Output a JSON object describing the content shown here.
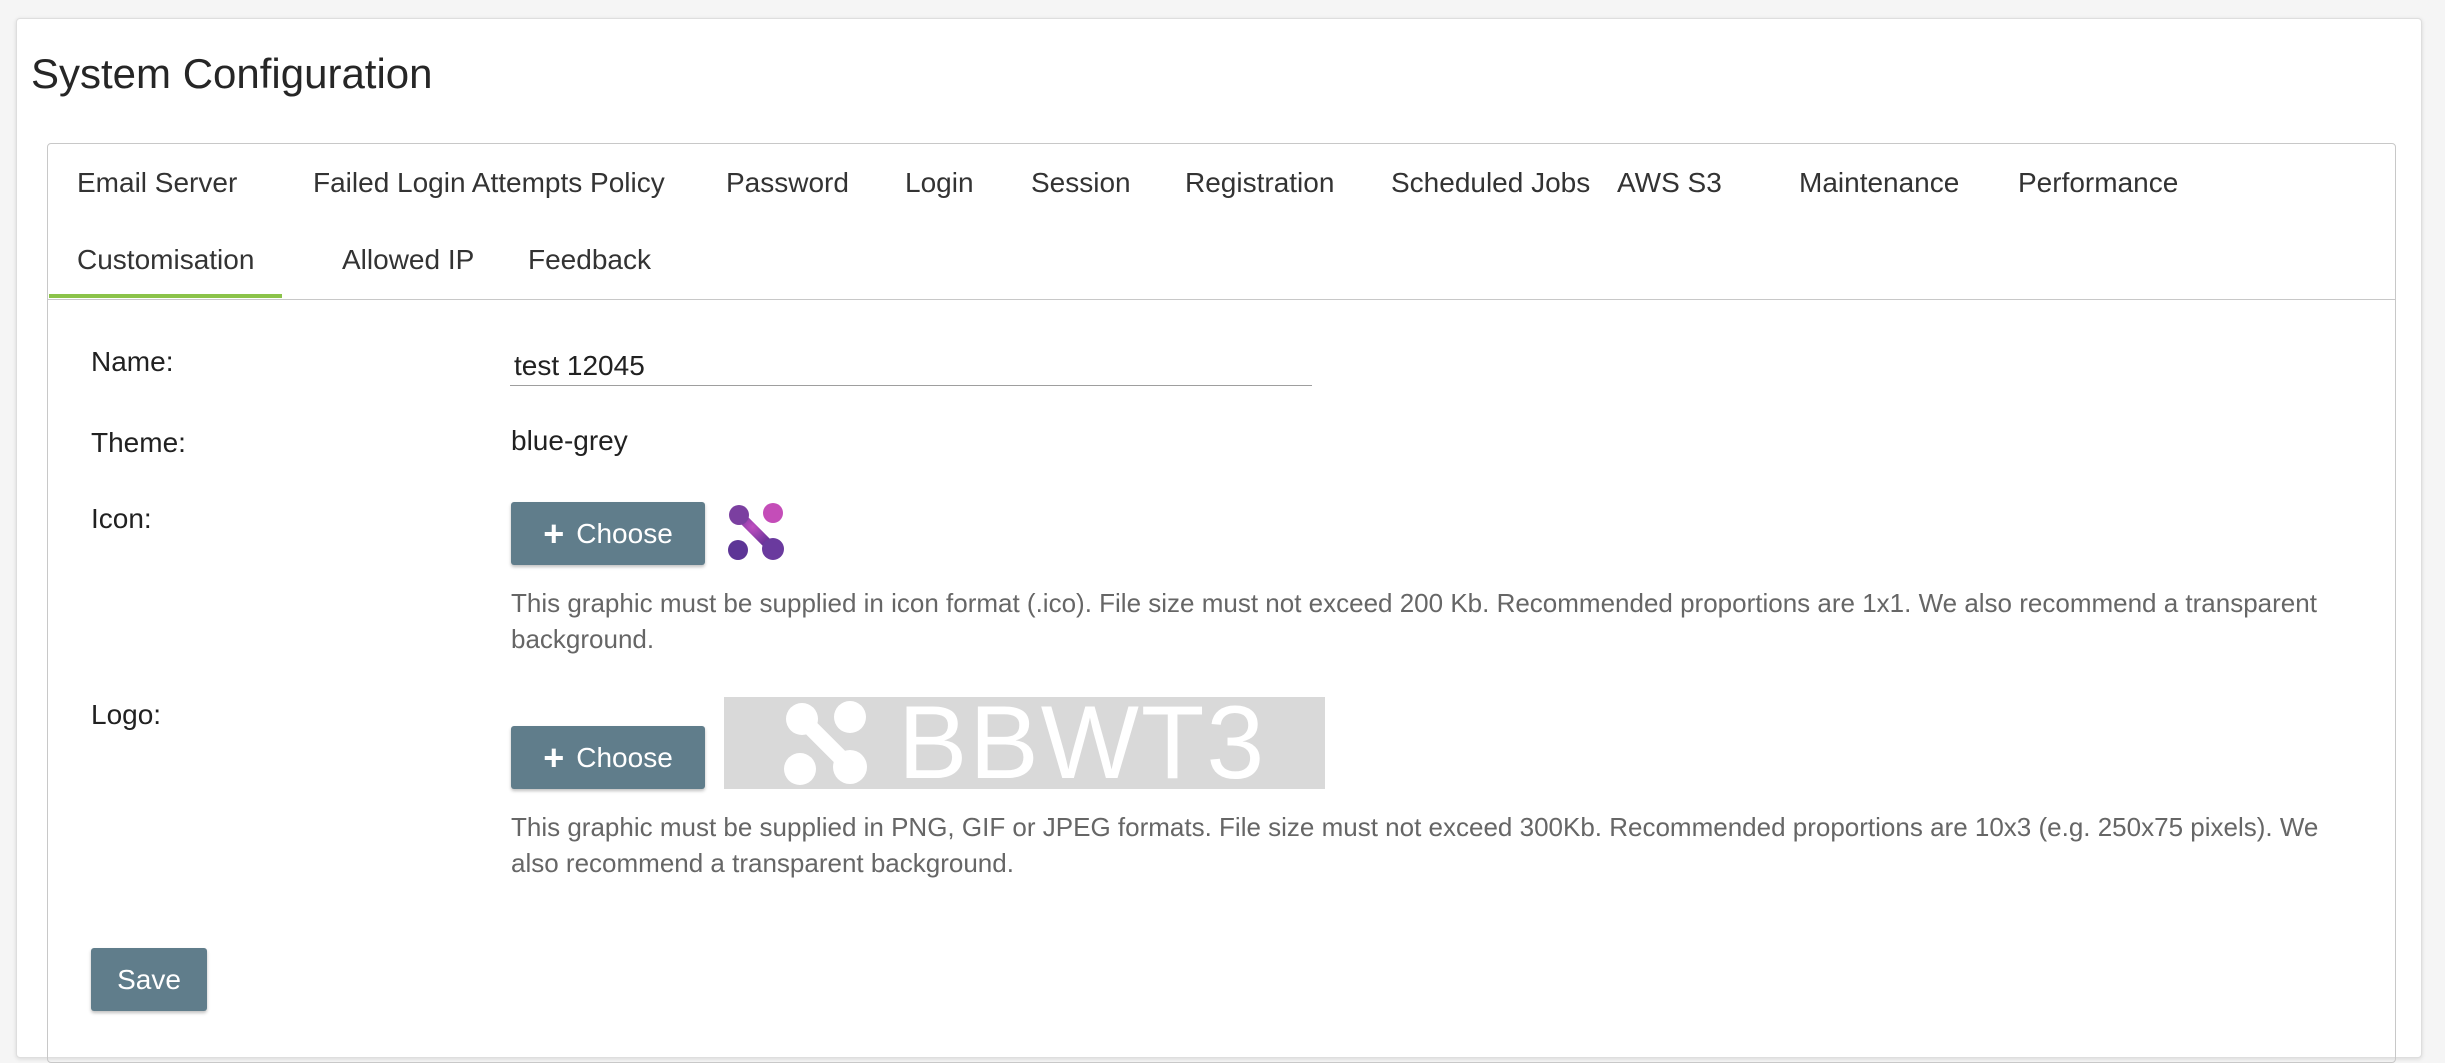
{
  "page": {
    "title": "System Configuration"
  },
  "tabs": [
    {
      "label": "Email Server"
    },
    {
      "label": "Failed Login Attempts Policy"
    },
    {
      "label": "Password"
    },
    {
      "label": "Login"
    },
    {
      "label": "Session"
    },
    {
      "label": "Registration"
    },
    {
      "label": "Scheduled Jobs"
    },
    {
      "label": "AWS S3"
    },
    {
      "label": "Maintenance"
    },
    {
      "label": "Performance"
    },
    {
      "label": "Customisation",
      "active": true
    },
    {
      "label": "Allowed IP"
    },
    {
      "label": "Feedback"
    }
  ],
  "form": {
    "name_label": "Name:",
    "name_value": "test 12045",
    "theme_label": "Theme:",
    "theme_value": "blue-grey",
    "icon_label": "Icon:",
    "icon_choose": "Choose",
    "icon_hint": "This graphic must be supplied in icon format (.ico). File size must not exceed 200 Kb. Recommended proportions are 1x1. We also recommend a transparent background.",
    "logo_label": "Logo:",
    "logo_choose": "Choose",
    "logo_preview_text": "BBWT3",
    "logo_hint": "This graphic must be supplied in PNG, GIF or JPEG formats. File size must not exceed 300Kb. Recommended proportions are 10x3 (e.g. 250x75 pixels). We also recommend a transparent background.",
    "save_label": "Save"
  },
  "icons": {
    "choose": "plus-icon",
    "icon_preview": "app-icon-purple",
    "logo_mark": "logo-mark-icon"
  },
  "colors": {
    "button": "#607d8b",
    "active_tab": "#8bc34a",
    "icon_preview": "#7b3fa0"
  }
}
